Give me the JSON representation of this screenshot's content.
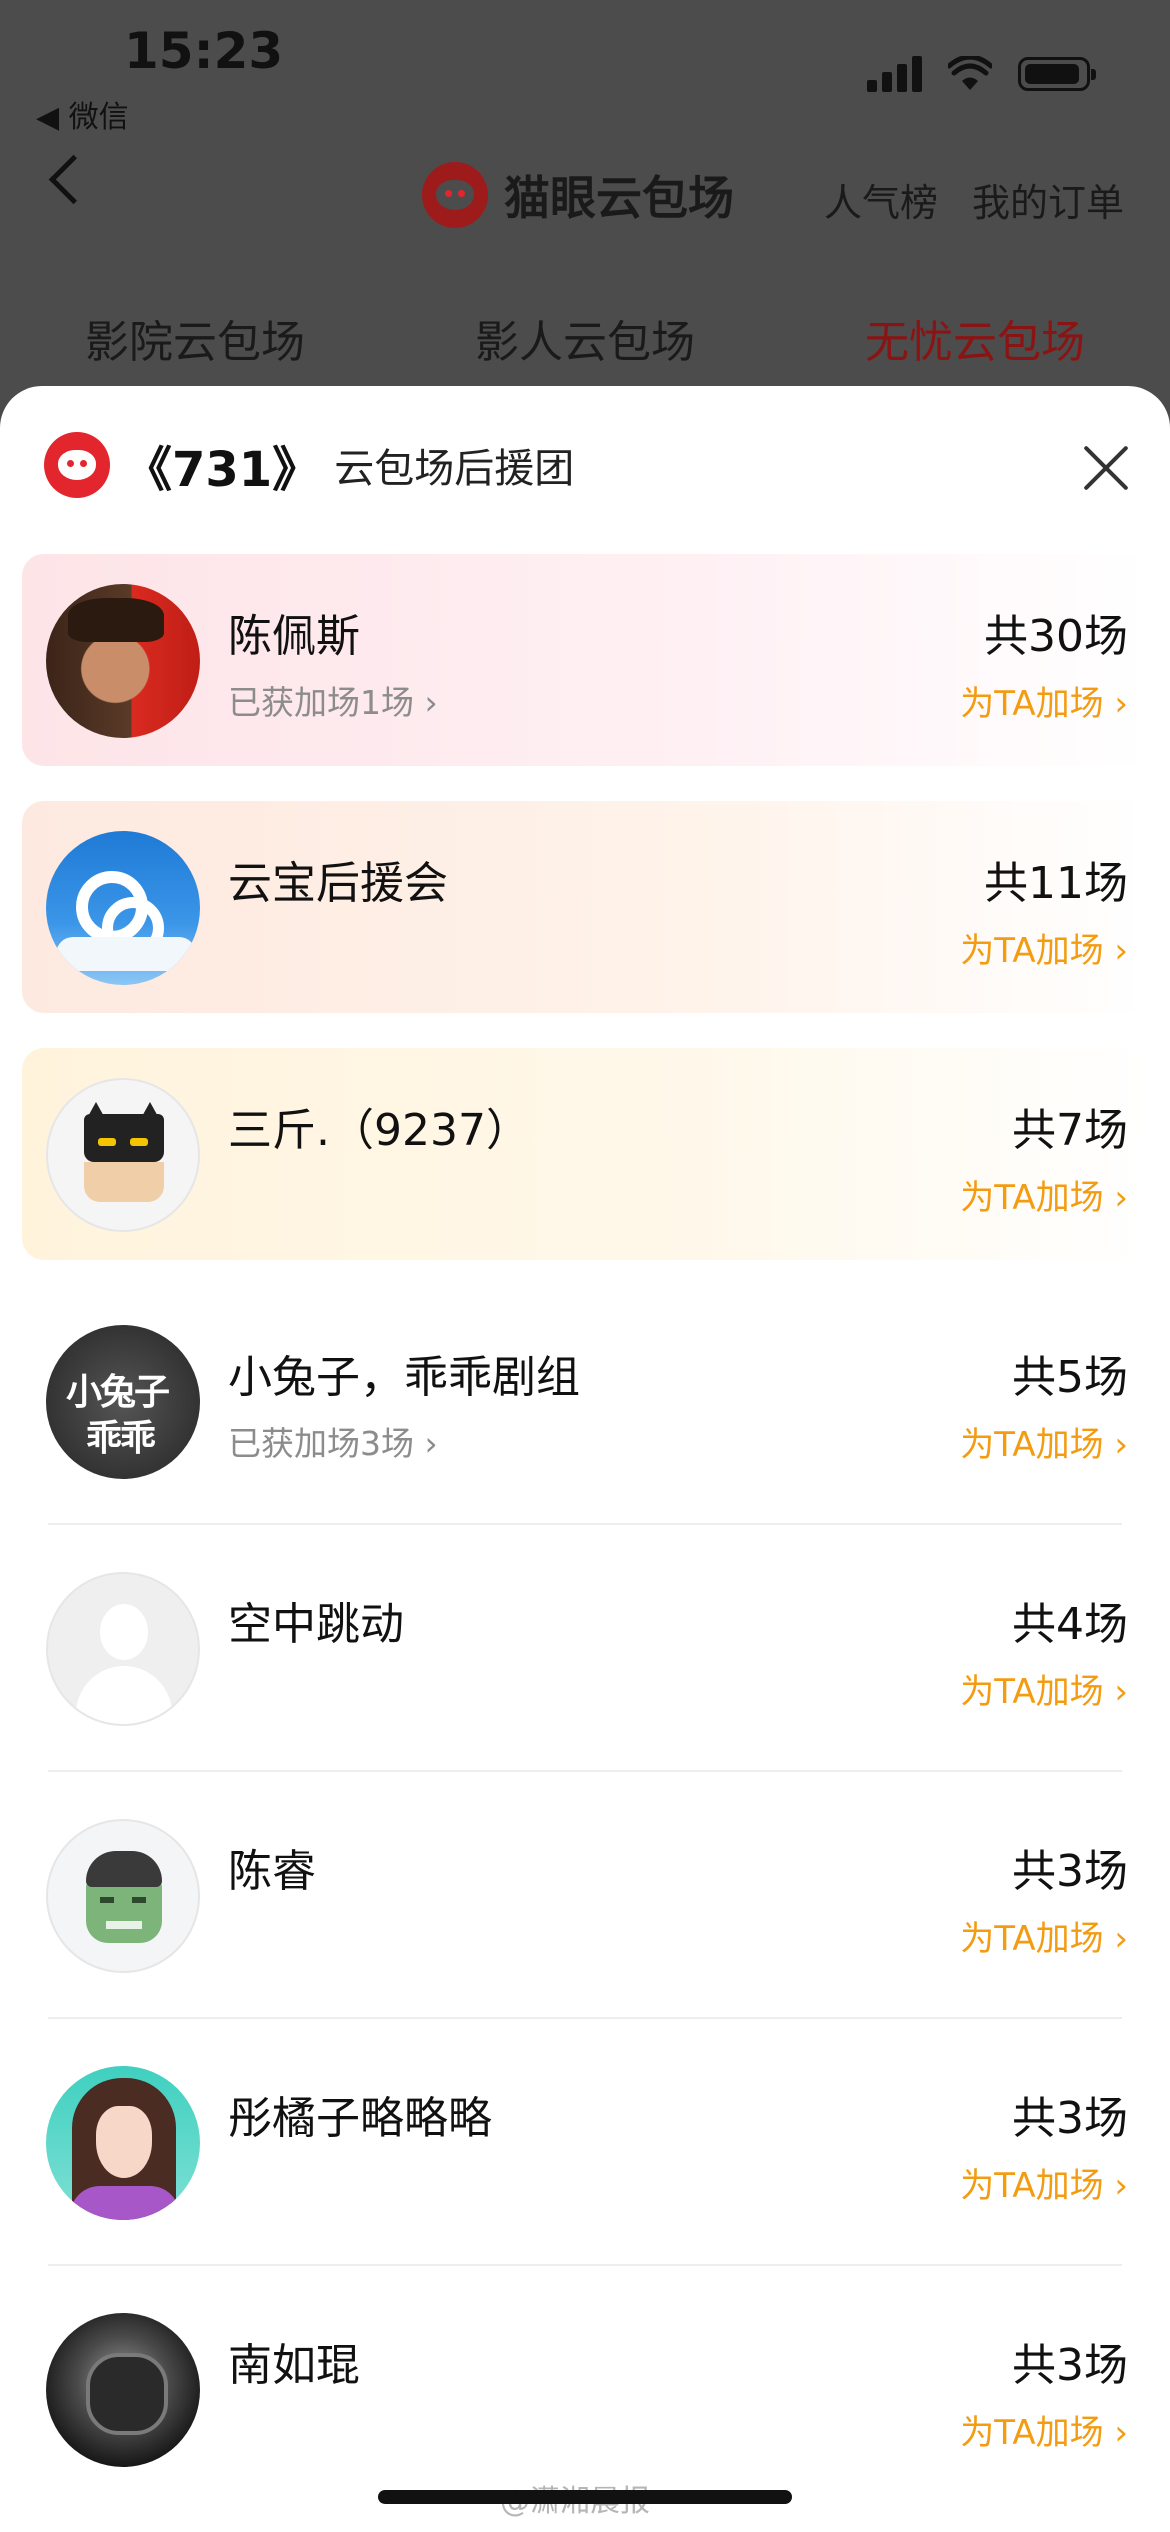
{
  "status_bar": {
    "time": "15:23",
    "back_app": "◀ 微信"
  },
  "nav": {
    "title": "猫眼云包场",
    "links": [
      "人气榜",
      "我的订单"
    ]
  },
  "bg_tabs": [
    {
      "label": "影院云包场",
      "active": false
    },
    {
      "label": "影人云包场",
      "active": false
    },
    {
      "label": "无忧云包场",
      "active": true
    }
  ],
  "sheet": {
    "movie": "《731》",
    "title": "云包场后援团"
  },
  "supporters": [
    {
      "name": "陈佩斯",
      "gained": "已获加场1场 ›",
      "count": "共30场",
      "cta": "为TA加场 ›",
      "avatar_icon": "avatar-chen-peisi"
    },
    {
      "name": "云宝后援会",
      "gained": "",
      "count": "共11场",
      "cta": "为TA加场 ›",
      "avatar_icon": "avatar-cloud-b"
    },
    {
      "name": "三斤.（9237）",
      "gained": "",
      "count": "共7场",
      "cta": "为TA加场 ›",
      "avatar_icon": "avatar-batman"
    },
    {
      "name": "小兔子，乖乖剧组",
      "gained": "已获加场3场 ›",
      "count": "共5场",
      "cta": "为TA加场 ›",
      "avatar_icon": "avatar-rabbit-text"
    },
    {
      "name": "空中跳动",
      "gained": "",
      "count": "共4场",
      "cta": "为TA加场 ›",
      "avatar_icon": "avatar-default"
    },
    {
      "name": "陈睿",
      "gained": "",
      "count": "共3场",
      "cta": "为TA加场 ›",
      "avatar_icon": "avatar-hulk"
    },
    {
      "name": "彤橘子略略略",
      "gained": "",
      "count": "共3场",
      "cta": "为TA加场 ›",
      "avatar_icon": "avatar-girl"
    },
    {
      "name": "南如琨",
      "gained": "",
      "count": "共3场",
      "cta": "为TA加场 ›",
      "avatar_icon": "avatar-dark"
    }
  ],
  "watermark": "@潇湘晨报",
  "colors": {
    "brand_red": "#e3252e",
    "cta_orange": "#f39c12",
    "active_tab": "#8a1414"
  }
}
